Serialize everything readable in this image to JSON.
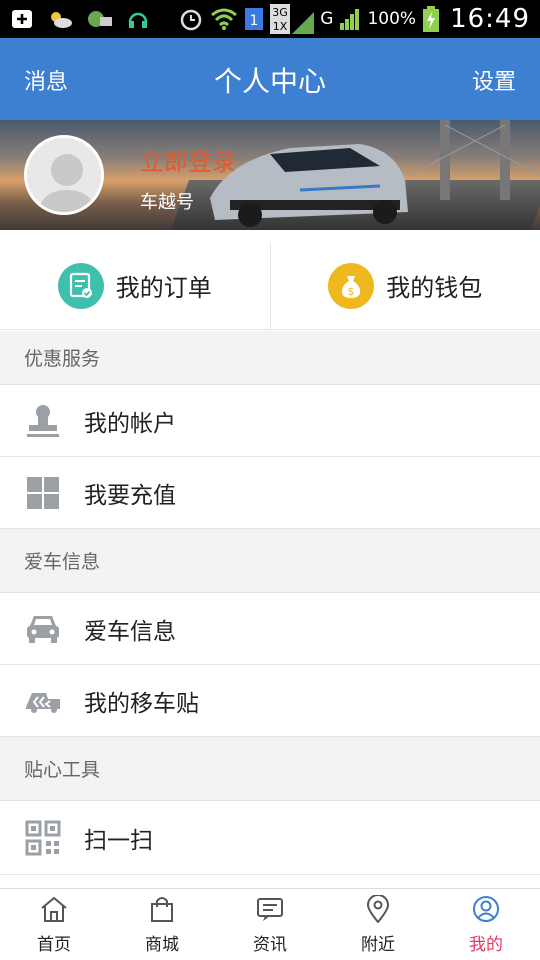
{
  "status_bar": {
    "battery": "100%",
    "time": "16:49",
    "network_top": "3G",
    "network_bottom": "1X",
    "carrier_small": "G",
    "sim_slot": "1"
  },
  "header": {
    "left": "消息",
    "title": "个人中心",
    "right": "设置"
  },
  "profile": {
    "login": "立即登录",
    "sub": "车越号"
  },
  "quick": {
    "orders": "我的订单",
    "wallet": "我的钱包"
  },
  "sections": [
    {
      "title": "优惠服务",
      "items": [
        {
          "label": "我的帐户",
          "icon": "stamp-icon"
        },
        {
          "label": "我要充值",
          "icon": "grid-icon"
        }
      ]
    },
    {
      "title": "爱车信息",
      "items": [
        {
          "label": "爱车信息",
          "icon": "car-icon"
        },
        {
          "label": "我的移车贴",
          "icon": "tow-truck-icon"
        }
      ]
    },
    {
      "title": "贴心工具",
      "items": [
        {
          "label": "扫一扫",
          "icon": "qr-code-icon"
        }
      ]
    }
  ],
  "bottom_nav": [
    {
      "label": "首页",
      "icon": "home-icon"
    },
    {
      "label": "商城",
      "icon": "shopping-bag-icon"
    },
    {
      "label": "资讯",
      "icon": "message-icon"
    },
    {
      "label": "附近",
      "icon": "location-pin-icon"
    },
    {
      "label": "我的",
      "icon": "user-icon"
    }
  ],
  "colors": {
    "header_bg": "#3d7fd1",
    "login_text": "#e25a2c",
    "nav_active": "#e23a62",
    "order_icon_bg": "#3fbfae",
    "wallet_icon_bg": "#f0b81f"
  }
}
